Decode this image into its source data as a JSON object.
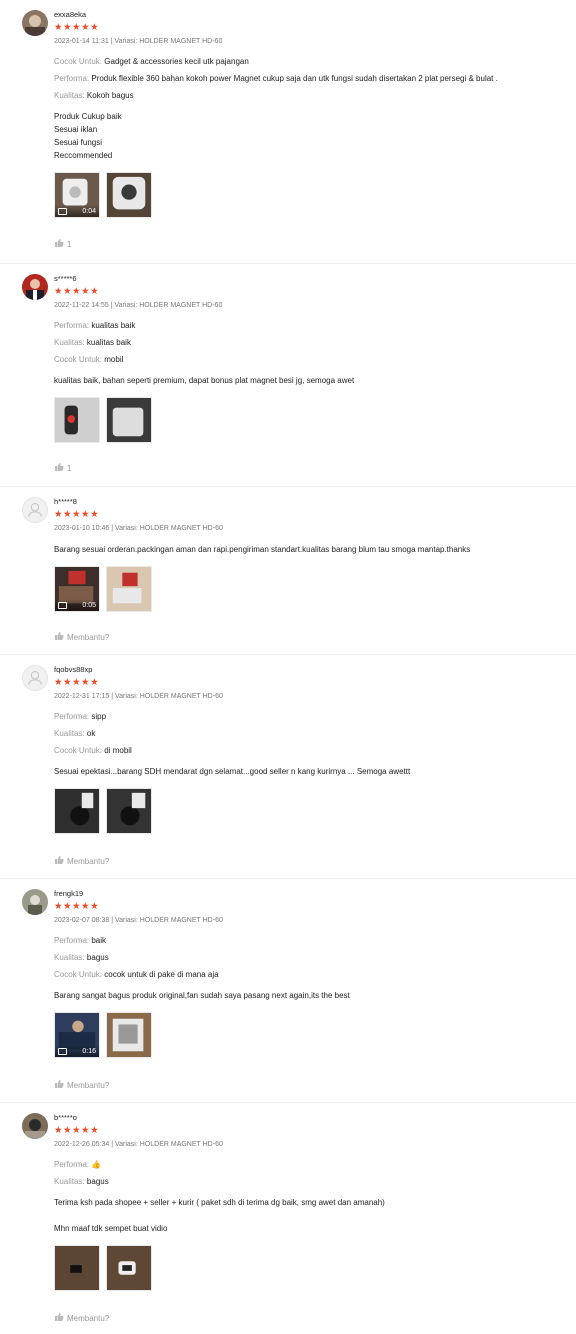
{
  "accent_color": "#ee4d2d",
  "reviews": [
    {
      "username": "exxa8eka",
      "stars": "★★★★★",
      "meta": "2023-01-14 11:31 | Variasi: HOLDER MAGNET HD-60",
      "attributes": [
        {
          "key": "Cocok Untuk:",
          "value": "Gadget & accessories kecil utk pajangan"
        },
        {
          "key": "Performa:",
          "value": "Produk flexible 360 bahan kokoh power Magnet cukup saja dan utk fungsi sudah disertakan 2 plat persegi & bulat ."
        },
        {
          "key": "Kualitas:",
          "value": "Kokoh bagus"
        }
      ],
      "text": "Produk Cukup baik\nSesuai iklan\nSesuai fungsi\nReccommended",
      "video_duration": "0:04",
      "like_label": "1"
    },
    {
      "username": "s*****6",
      "stars": "★★★★★",
      "meta": "2022-11-22 14:55 | Variasi: HOLDER MAGNET HD-60",
      "attributes": [
        {
          "key": "Performa:",
          "value": "kualitas baik"
        },
        {
          "key": "Kualitas:",
          "value": "kualitas baik"
        },
        {
          "key": "Cocok Untuk:",
          "value": "mobil"
        }
      ],
      "text": "kualitas baik, bahan seperti premium, dapat bonus plat magnet besi jg, semoga awet",
      "like_label": "1"
    },
    {
      "username": "h*****8",
      "stars": "★★★★★",
      "meta": "2023-01-10 10:46 | Variasi: HOLDER MAGNET HD-60",
      "text": "Barang sesuai orderan.packingan aman dan rapi.pengiriman standart.kualitas barang blum tau smoga mantap.thanks",
      "video_duration": "0:05",
      "like_label": "Membantu?"
    },
    {
      "username": "fqobvs88xp",
      "stars": "★★★★★",
      "meta": "2022-12-31 17:15 | Variasi: HOLDER MAGNET HD-60",
      "attributes": [
        {
          "key": "Performa:",
          "value": "sipp"
        },
        {
          "key": "Kualitas:",
          "value": "ok"
        },
        {
          "key": "Cocok Untuk:",
          "value": "di mobil"
        }
      ],
      "text": "Sesuai epektasi...barang SDH mendarat dgn selamat...good seller n kang kurirnya ... Semoga awettt",
      "like_label": "Membantu?"
    },
    {
      "username": "frengk19",
      "stars": "★★★★★",
      "meta": "2023-02-07 08:38 | Variasi: HOLDER MAGNET HD-60",
      "attributes": [
        {
          "key": "Performa:",
          "value": "baik"
        },
        {
          "key": "Kualitas:",
          "value": "bagus"
        },
        {
          "key": "Cocok Untuk:",
          "value": "cocok untuk di pake di mana aja"
        }
      ],
      "text": "Barang sangat bagus produk original,fan sudah saya pasang next again,its the best",
      "video_duration": "0:16",
      "like_label": "Membantu?"
    },
    {
      "username": "b*****o",
      "stars": "★★★★★",
      "meta": "2022-12-26 05:34 | Variasi: HOLDER MAGNET HD-60",
      "attributes": [
        {
          "key": "Performa:",
          "value": "👍"
        },
        {
          "key": "Kualitas:",
          "value": "bagus"
        }
      ],
      "text": "Terima ksh pada shopee + seller + kurir ( paket sdh di terima dg baik, smg awet dan amanah)\n\nMhn maaf tdk sempet buat vidio",
      "like_label": "Membantu?"
    }
  ]
}
